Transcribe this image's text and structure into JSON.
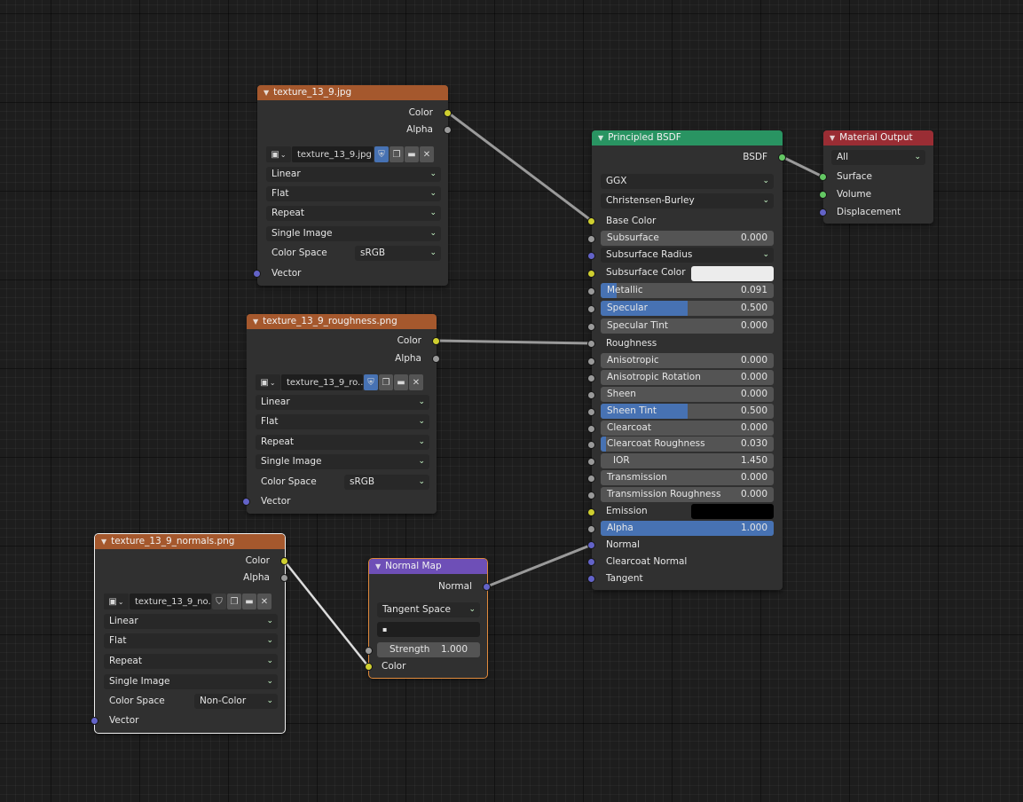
{
  "colors": {
    "texture_header": "#a5582d",
    "shader_header": "#299462",
    "output_header": "#9a2d34",
    "vector_header": "#6e4fb7",
    "socket_color": "#cfcf30",
    "socket_float": "#9a9a9a",
    "socket_vector": "#6363c8",
    "socket_shader": "#63c763",
    "slider_fill": "#4772b3"
  },
  "texture1": {
    "title": "texture_13_9.jpg",
    "out_color": "Color",
    "out_alpha": "Alpha",
    "image_name": "texture_13_9.jpg",
    "interpolation": "Linear",
    "projection": "Flat",
    "extension": "Repeat",
    "source": "Single Image",
    "color_space_label": "Color Space",
    "color_space": "sRGB",
    "in_vector": "Vector"
  },
  "texture2": {
    "title": "texture_13_9_roughness.png",
    "out_color": "Color",
    "out_alpha": "Alpha",
    "image_name": "texture_13_9_ro...",
    "interpolation": "Linear",
    "projection": "Flat",
    "extension": "Repeat",
    "source": "Single Image",
    "color_space_label": "Color Space",
    "color_space": "sRGB",
    "in_vector": "Vector"
  },
  "texture3": {
    "title": "texture_13_9_normals.png",
    "out_color": "Color",
    "out_alpha": "Alpha",
    "image_name": "texture_13_9_no...",
    "interpolation": "Linear",
    "projection": "Flat",
    "extension": "Repeat",
    "source": "Single Image",
    "color_space_label": "Color Space",
    "color_space": "Non-Color",
    "in_vector": "Vector"
  },
  "normal_map": {
    "title": "Normal Map",
    "out_normal": "Normal",
    "space": "Tangent Space",
    "uv_field": "▪",
    "strength_label": "Strength",
    "strength_value": "1.000",
    "in_color": "Color"
  },
  "bsdf": {
    "title": "Principled BSDF",
    "out_bsdf": "BSDF",
    "distribution": "GGX",
    "subsurface_method": "Christensen-Burley",
    "base_color": "Base Color",
    "subsurface_radius": "Subsurface Radius",
    "subsurface_color": "Subsurface Color",
    "subsurface_color_swatch": "#ececec",
    "roughness": "Roughness",
    "emission": "Emission",
    "emission_swatch": "#000000",
    "normal": "Normal",
    "clearcoat_normal": "Clearcoat Normal",
    "tangent": "Tangent",
    "fields": [
      {
        "label": "Subsurface",
        "value": "0.000",
        "fill": 0.0
      },
      {
        "label": "Metallic",
        "value": "0.091",
        "fill": 0.091
      },
      {
        "label": "Specular",
        "value": "0.500",
        "fill": 0.5
      },
      {
        "label": "Specular Tint",
        "value": "0.000",
        "fill": 0.0
      },
      {
        "label": "Anisotropic",
        "value": "0.000",
        "fill": 0.0
      },
      {
        "label": "Anisotropic Rotation",
        "value": "0.000",
        "fill": 0.0
      },
      {
        "label": "Sheen",
        "value": "0.000",
        "fill": 0.0
      },
      {
        "label": "Sheen Tint",
        "value": "0.500",
        "fill": 0.5
      },
      {
        "label": "Clearcoat",
        "value": "0.000",
        "fill": 0.0
      },
      {
        "label": "Clearcoat Roughness",
        "value": "0.030",
        "fill": 0.03
      },
      {
        "label": "IOR",
        "value": "1.450",
        "fill": 0.0
      },
      {
        "label": "Transmission",
        "value": "0.000",
        "fill": 0.0
      },
      {
        "label": "Transmission Roughness",
        "value": "0.000",
        "fill": 0.0
      },
      {
        "label": "Alpha",
        "value": "1.000",
        "fill": 1.0
      }
    ]
  },
  "material_output": {
    "title": "Material Output",
    "target": "All",
    "in_surface": "Surface",
    "in_volume": "Volume",
    "in_displacement": "Displacement"
  }
}
